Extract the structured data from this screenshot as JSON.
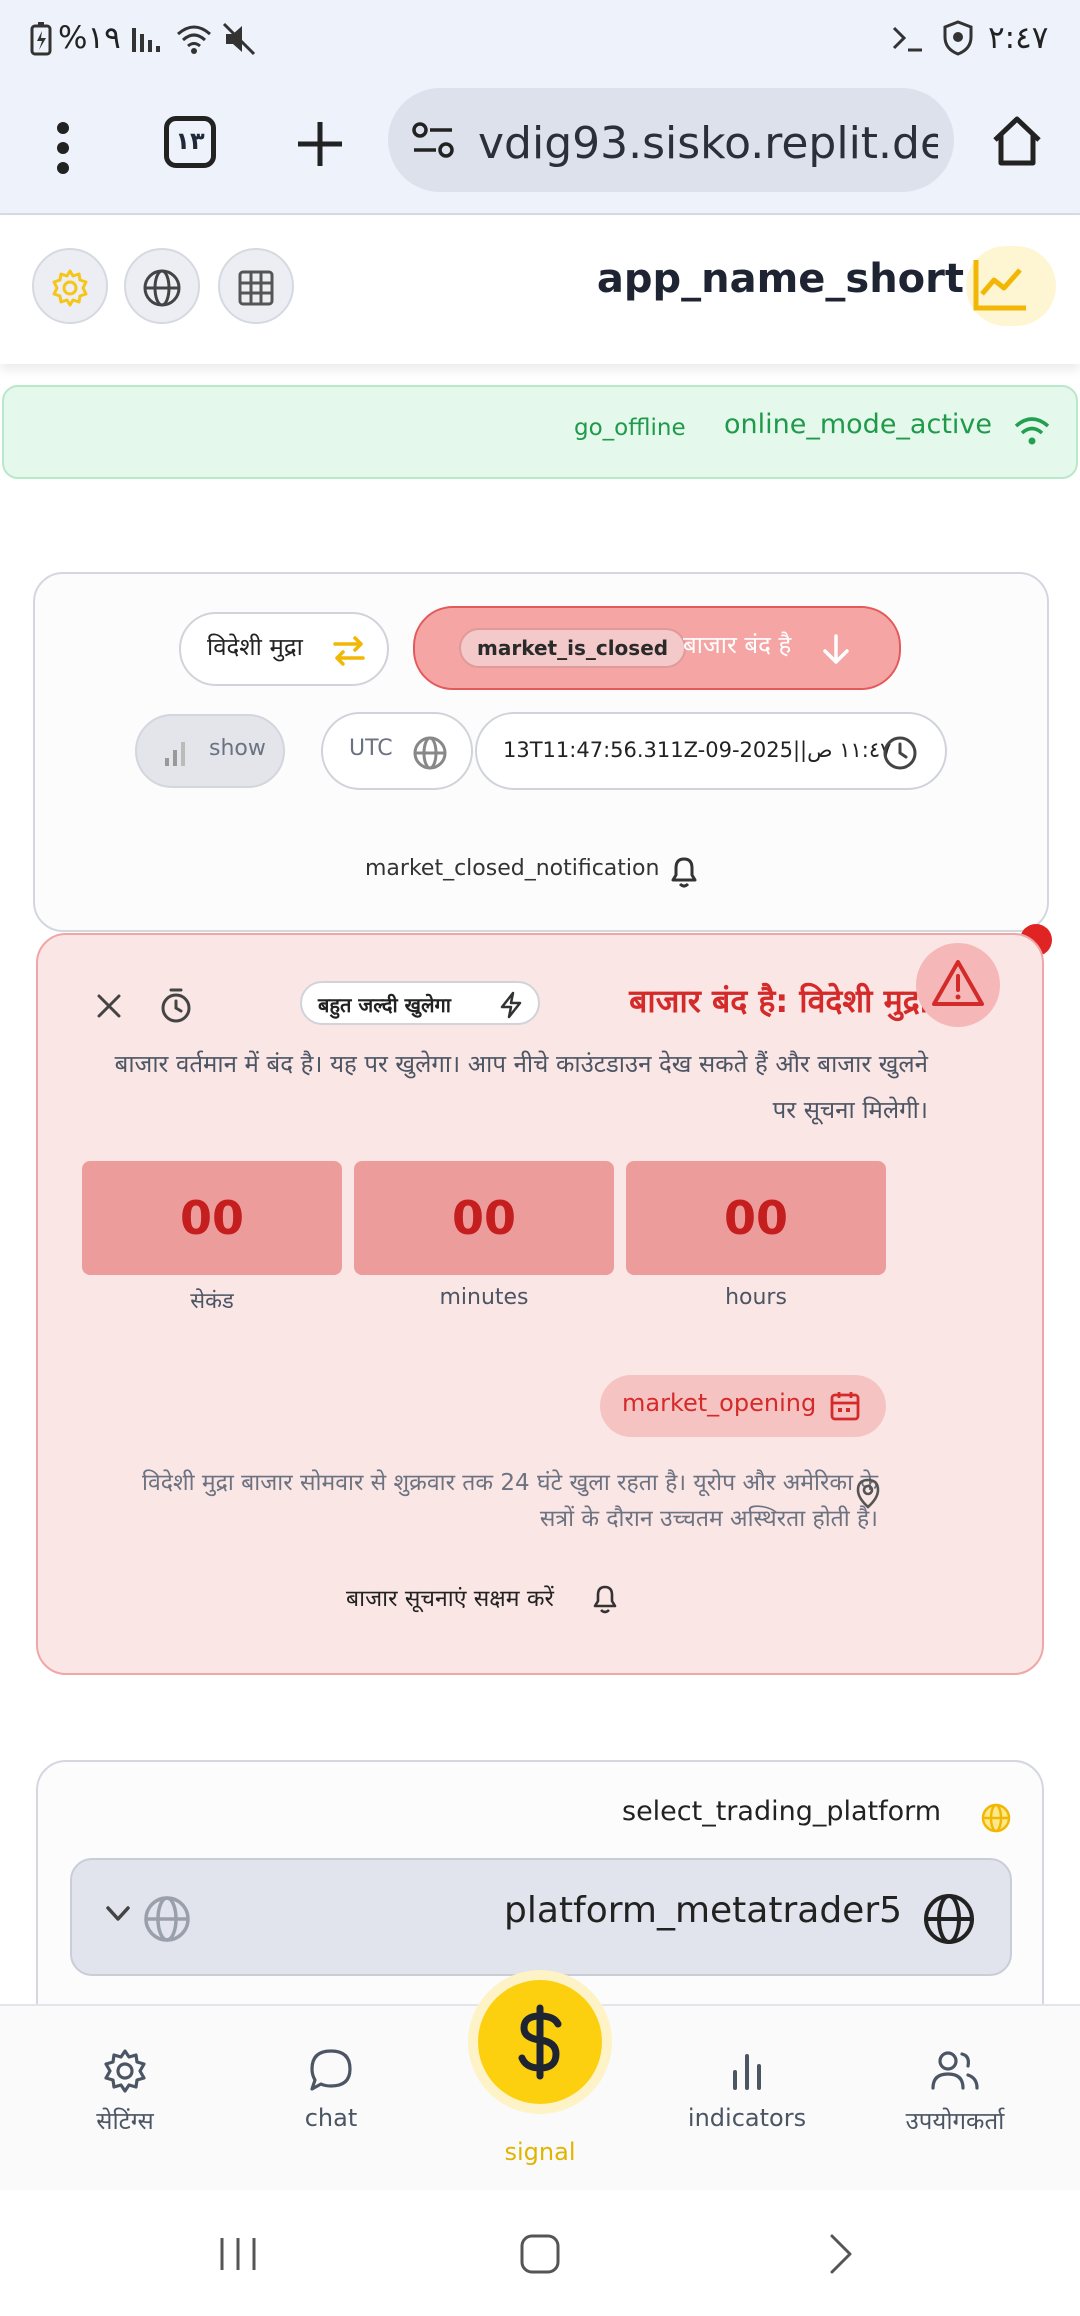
{
  "status_bar": {
    "battery": "%١٩",
    "time": "٢:٤٧"
  },
  "browser": {
    "url": "vdig93.sisko.replit.dev",
    "tab_count": "١٣"
  },
  "header": {
    "app_name": "app_name_short"
  },
  "connection": {
    "status": "online_mode_active",
    "action": "go_offline"
  },
  "market": {
    "type_label": "विदेशी मुद्रा",
    "closed_badge": "market_is_closed",
    "closed_text": "बाजार बंद है",
    "show_label": "show",
    "timezone": "UTC",
    "timestamp": "13T11:47:56.311Z-09-2025||١١:٤٧ ص",
    "notification": "market_closed_notification"
  },
  "closed_panel": {
    "title": "बाजार बंद है: विदेशी मुद्रा",
    "soon_badge": "बहुत जल्दी खुलेगा",
    "description": "बाजार वर्तमान में बंद है। यह पर खुलेगा। आप नीचे काउंटडाउन देख सकते हैं और बाजार खुलने पर सूचना मिलेगी।",
    "countdown": [
      {
        "value": "00",
        "label": "सेकंड"
      },
      {
        "value": "00",
        "label": "minutes"
      },
      {
        "value": "00",
        "label": "hours"
      }
    ],
    "opening_label": "market_opening",
    "info": "विदेशी मुद्रा बाजार सोमवार से शुक्रवार तक 24 घंटे खुला रहता है। यूरोप और अमेरिका के सत्रों के दौरान उच्चतम अस्थिरता होती है।",
    "enable_alerts": "बाजार सूचनाएं सक्षम करें"
  },
  "platform": {
    "heading": "select_trading_platform",
    "selected": "platform_metatrader5"
  },
  "bottom_nav": {
    "settings": "सेटिंग्स",
    "chat": "chat",
    "signal": "signal",
    "indicators": "indicators",
    "users": "उपयोगकर्ता"
  },
  "colors": {
    "accent_yellow": "#fcd00f",
    "danger_red": "#d42a2a",
    "online_green": "#22a04f"
  }
}
